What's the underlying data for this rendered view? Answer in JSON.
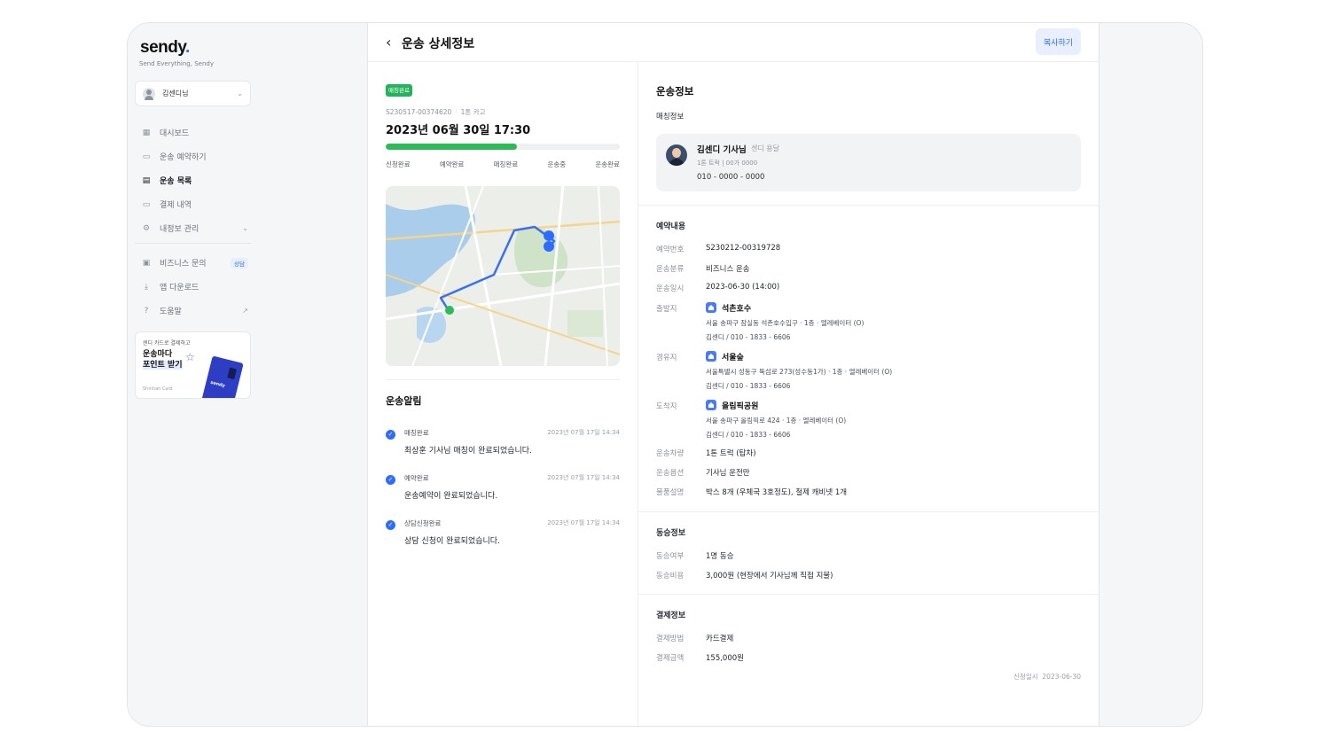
{
  "sidebar": {
    "logo": "sendy",
    "logo_dot": ".",
    "tagline": "Send Everything, Sendy",
    "user_name": "김센디님",
    "nav": [
      {
        "label": "대시보드"
      },
      {
        "label": "운송 예약하기"
      },
      {
        "label": "운송 목록"
      },
      {
        "label": "결제 내역"
      },
      {
        "label": "내정보 관리"
      }
    ],
    "nav2": [
      {
        "label": "비즈니스 문의",
        "badge": "상담"
      },
      {
        "label": "앱 다운로드"
      },
      {
        "label": "도움말"
      }
    ],
    "promo": {
      "small": "센디 카드로 결제하고",
      "title_line1": "운송마다",
      "title_line2": "포인트 받기",
      "brand": "Shinhan Card",
      "card_text": "sendy"
    }
  },
  "header": {
    "title": "운송 상세정보",
    "copy_button": "복사하기"
  },
  "order": {
    "status_badge": "매칭완료",
    "order_no": "S230517-00374620",
    "cargo": "1톤 카고",
    "datetime": "2023년 06월 30일 17:30",
    "progress": 0.56,
    "steps": [
      "신청완료",
      "예약완료",
      "매칭완료",
      "운송중",
      "운송완료"
    ]
  },
  "notifications": {
    "title": "운송알림",
    "items": [
      {
        "status": "매칭완료",
        "time": "2023년 07월 17일 14:34",
        "message": "최상훈 기사님 매칭이 완료되었습니다."
      },
      {
        "status": "예약완료",
        "time": "2023년 07월 17일 14:34",
        "message": "운송예약이 완료되었습니다."
      },
      {
        "status": "상담신청완료",
        "time": "2023년 07월 17일 14:34",
        "message": "상담 신청이 완료되었습니다."
      }
    ]
  },
  "transport_info": {
    "title": "운송정보",
    "matching_title": "매칭정보",
    "driver": {
      "name": "김센디 기사님",
      "tag": "센디 용달",
      "truck": "1톤 트럭 | 00가 0000",
      "phone": "010 - 0000 - 0000"
    }
  },
  "reservation": {
    "title": "예약내용",
    "order_no_label": "예약번호",
    "order_no": "S230212-00319728",
    "type_label": "운송분류",
    "type": "비즈니스 운송",
    "date_label": "운송일시",
    "date": "2023-06-30 (14:00)",
    "origin": {
      "label": "출발지",
      "name": "석촌호수",
      "address": "서울 송파구 잠실동 석촌호수입구 · 1층 · 엘레베이터 (O)",
      "contact": "김센디 / 010 - 1833 - 6606"
    },
    "waypoint": {
      "label": "경유지",
      "name": "서울숲",
      "address": "서울특별시 성동구 뚝섬로 273(성수동1가) · 1층 · 엘레베이터 (O)",
      "contact": "김센디 / 010 - 1833 - 6606"
    },
    "destination": {
      "label": "도착지",
      "name": "올림픽공원",
      "address": "서울 송파구 올림픽로 424 · 1층 · 엘레베이터 (O)",
      "contact": "김센디 / 010 - 1833 - 6606"
    },
    "vehicle_label": "운송차량",
    "vehicle": "1톤 트럭 (탑차)",
    "option_label": "운송옵션",
    "option": "기사님 운전만",
    "cargo_label": "물품설명",
    "cargo": "박스 8개 (우체국 3호정도), 철제 캐비넷 1개"
  },
  "rideshare": {
    "title": "동승정보",
    "whether_label": "동승여부",
    "whether": "1명 동승",
    "cost_label": "동승비용",
    "cost": "3,000원 (현장에서 기사님께 직접 지불)"
  },
  "payment": {
    "title": "결제정보",
    "method_label": "결제방법",
    "method": "카드결제",
    "amount_label": "결제금액",
    "amount": "155,000원",
    "applied_label": "신청일시",
    "applied_date": "2023-06-30"
  },
  "colors": {
    "accent": "#2f6bff",
    "success": "#2dbb57",
    "route": "#3a6ff0"
  }
}
